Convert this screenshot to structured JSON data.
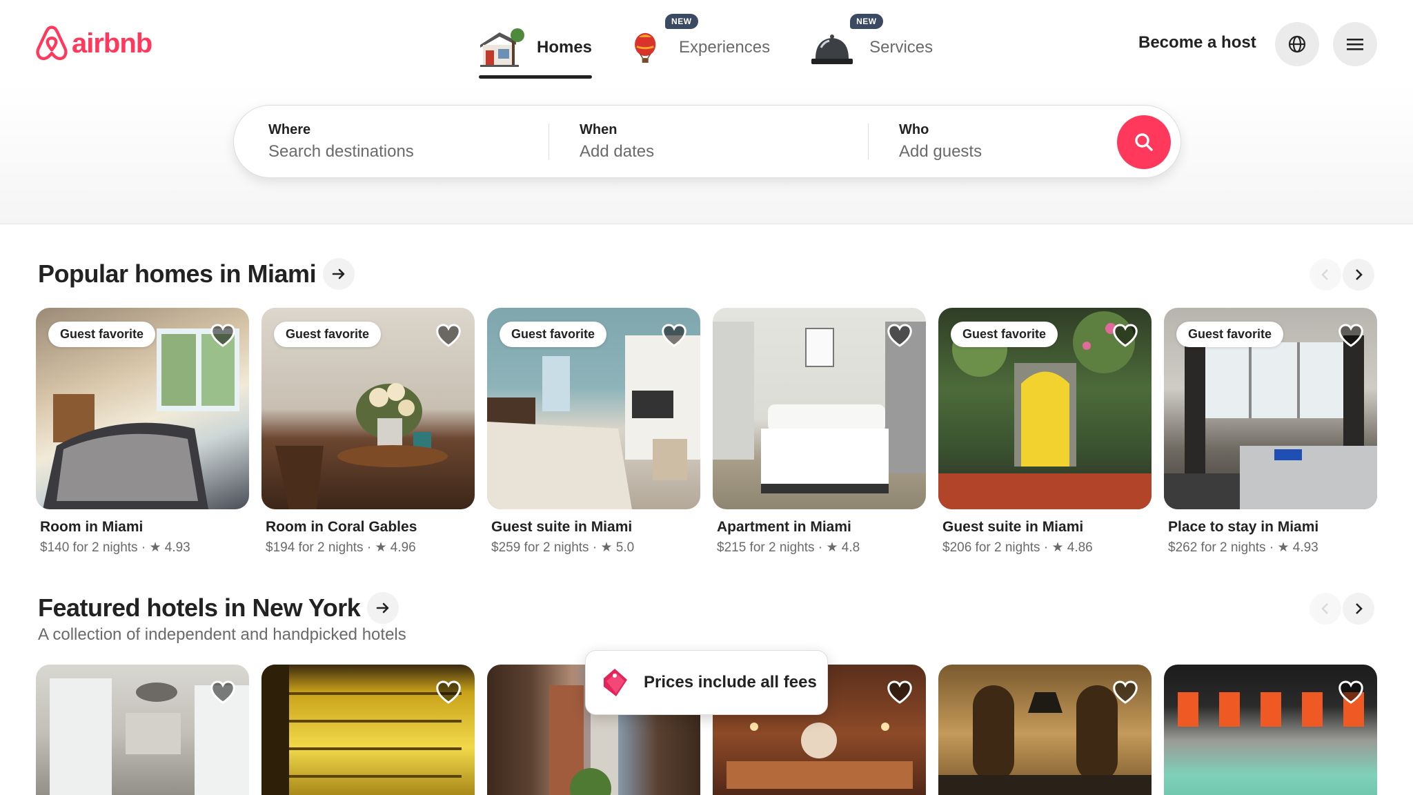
{
  "brand": {
    "name": "airbnb",
    "color": "#ff385c"
  },
  "nav": {
    "tabs": [
      {
        "label": "Homes",
        "icon": "house-icon",
        "badge": "",
        "active": true
      },
      {
        "label": "Experiences",
        "icon": "hot-air-balloon-icon",
        "badge": "NEW",
        "active": false
      },
      {
        "label": "Services",
        "icon": "service-bell-icon",
        "badge": "NEW",
        "active": false
      }
    ],
    "become_host": "Become a host"
  },
  "search": {
    "where": {
      "label": "Where",
      "placeholder": "Search destinations"
    },
    "when": {
      "label": "When",
      "placeholder": "Add dates"
    },
    "who": {
      "label": "Who",
      "placeholder": "Add guests"
    }
  },
  "sections": [
    {
      "title": "Popular homes in Miami",
      "subtitle": "",
      "cards": [
        {
          "badge": "Guest favorite",
          "title": "Room in Miami",
          "price": "$140 for 2 nights",
          "rating": "4.93"
        },
        {
          "badge": "Guest favorite",
          "title": "Room in Coral Gables",
          "price": "$194 for 2 nights",
          "rating": "4.96"
        },
        {
          "badge": "Guest favorite",
          "title": "Guest suite in Miami",
          "price": "$259 for 2 nights",
          "rating": "5.0"
        },
        {
          "badge": "",
          "title": "Apartment in Miami",
          "price": "$215 for 2 nights",
          "rating": "4.8"
        },
        {
          "badge": "Guest favorite",
          "title": "Guest suite in Miami",
          "price": "$206 for 2 nights",
          "rating": "4.86"
        },
        {
          "badge": "Guest favorite",
          "title": "Place to stay in Miami",
          "price": "$262 for 2 nights",
          "rating": "4.93"
        }
      ]
    },
    {
      "title": "Featured hotels in New York",
      "subtitle": "A collection of independent and handpicked hotels",
      "cards": [
        {
          "badge": "",
          "title": "",
          "price": "",
          "rating": ""
        },
        {
          "badge": "",
          "title": "",
          "price": "",
          "rating": ""
        },
        {
          "badge": "",
          "title": "",
          "price": "",
          "rating": ""
        },
        {
          "badge": "",
          "title": "",
          "price": "",
          "rating": ""
        },
        {
          "badge": "",
          "title": "",
          "price": "",
          "rating": ""
        },
        {
          "badge": "",
          "title": "",
          "price": "",
          "rating": ""
        }
      ]
    }
  ],
  "toast": {
    "text": "Prices include all fees",
    "icon": "price-tag-icon"
  }
}
